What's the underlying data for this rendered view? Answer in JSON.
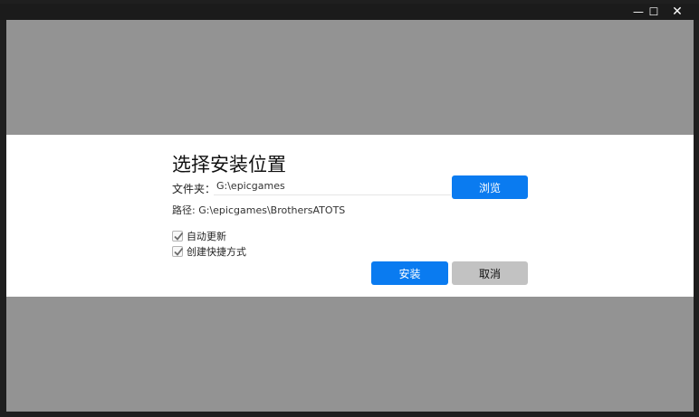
{
  "window": {
    "controls": {
      "minimize": "—",
      "maximize": "☐",
      "close": "✕"
    }
  },
  "dialog": {
    "title": "选择安装位置",
    "folder_label": "文件夹：",
    "folder_value": "G:\\epicgames",
    "browse_label": "浏览",
    "path_label": "路径:",
    "path_value": "G:\\epicgames\\BrothersATOTS",
    "options": [
      {
        "label": "自动更新",
        "checked": true
      },
      {
        "label": "创建快捷方式",
        "checked": true
      }
    ],
    "install_label": "安装",
    "cancel_label": "取消"
  },
  "colors": {
    "accent": "#0a7bf0",
    "overlay": "#939393",
    "cancel_bg": "#c2c2c2"
  },
  "icons": [
    "minimize-icon",
    "maximize-icon",
    "close-icon",
    "checkmark-icon"
  ]
}
